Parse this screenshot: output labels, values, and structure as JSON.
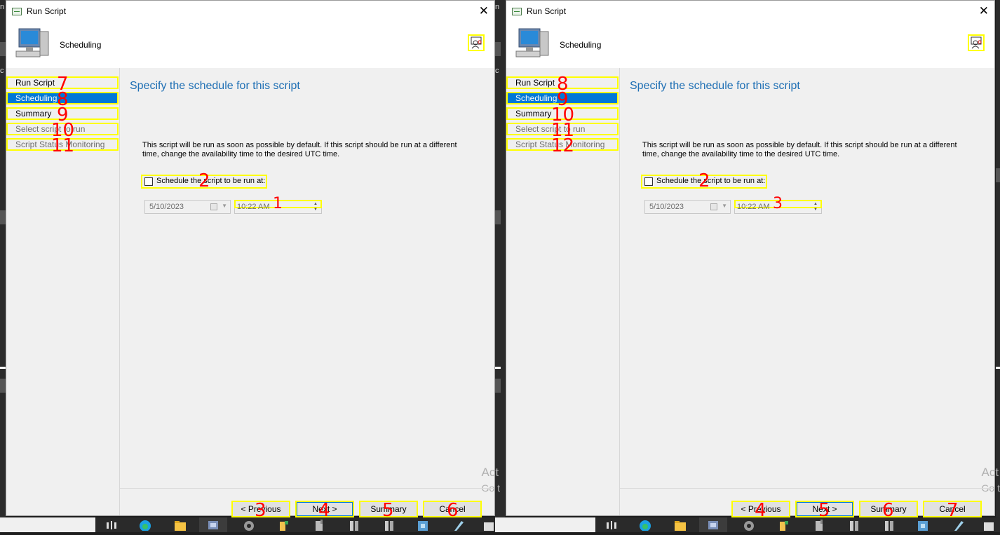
{
  "windows": [
    {
      "title": "Run Script",
      "header": {
        "title": "Scheduling"
      },
      "nav": [
        {
          "label": "Run Script",
          "state": "normal",
          "mark": "7"
        },
        {
          "label": "Scheduling",
          "state": "selected",
          "mark": "8"
        },
        {
          "label": "Summary",
          "state": "normal",
          "mark": "9"
        },
        {
          "label": "Select script to run",
          "state": "disabled",
          "mark": "10"
        },
        {
          "label": "Script Status Monitoring",
          "state": "disabled",
          "mark": "11"
        }
      ],
      "content": {
        "heading": "Specify the schedule for this script",
        "description": "This script will be run as soon as possible by default. If this script should be run at a different time, change the availability time to the desired UTC time.",
        "checkbox_label": "Schedule the script to be run at:",
        "checkbox_mark": "2",
        "date_value": "5/10/2023",
        "time_value": "10:22 AM",
        "time_mark": "1",
        "watermark_line1": "Act",
        "watermark_line2": "Go t"
      },
      "buttons": {
        "previous": "< Previous",
        "previous_mark": "3",
        "next": "Next >",
        "next_mark": "4",
        "summary": "Summary",
        "summary_mark": "5",
        "cancel": "Cancel",
        "cancel_mark": "6"
      }
    },
    {
      "title": "Run Script",
      "header": {
        "title": "Scheduling"
      },
      "nav": [
        {
          "label": "Run Script",
          "state": "normal",
          "mark": "8"
        },
        {
          "label": "Scheduling",
          "state": "selected",
          "mark": "9"
        },
        {
          "label": "Summary",
          "state": "normal",
          "mark": "10"
        },
        {
          "label": "Select script to run",
          "state": "disabled",
          "mark": "11"
        },
        {
          "label": "Script Status Monitoring",
          "state": "disabled",
          "mark": "12"
        }
      ],
      "content": {
        "heading": "Specify the schedule for this script",
        "description": "This script will be run as soon as possible by default. If this script should be run at a different time, change the availability time to the desired UTC time.",
        "checkbox_label": "Schedule the script to be run at:",
        "checkbox_mark": "2",
        "date_value": "5/10/2023",
        "time_value": "10:22 AM",
        "time_mark": "3",
        "watermark_line1": "Act",
        "watermark_line2": "Go t"
      },
      "buttons": {
        "previous": "< Previous",
        "previous_mark": "4",
        "next": "Next >",
        "next_mark": "5",
        "summary": "Summary",
        "summary_mark": "6",
        "cancel": "Cancel",
        "cancel_mark": "7"
      }
    }
  ],
  "colors": {
    "accent": "#0078d7",
    "heading": "#1e6fb4",
    "highlight": "#ffff00",
    "annotation": "#ff0000"
  },
  "taskbar_icons": [
    "task-view-icon",
    "edge-icon",
    "file-explorer-icon",
    "config-manager-icon",
    "settings-icon",
    "tool-icon",
    "server-icon",
    "server-manager-icon",
    "server-manager-icon",
    "network-icon",
    "notepad-icon",
    "folder-icon"
  ]
}
